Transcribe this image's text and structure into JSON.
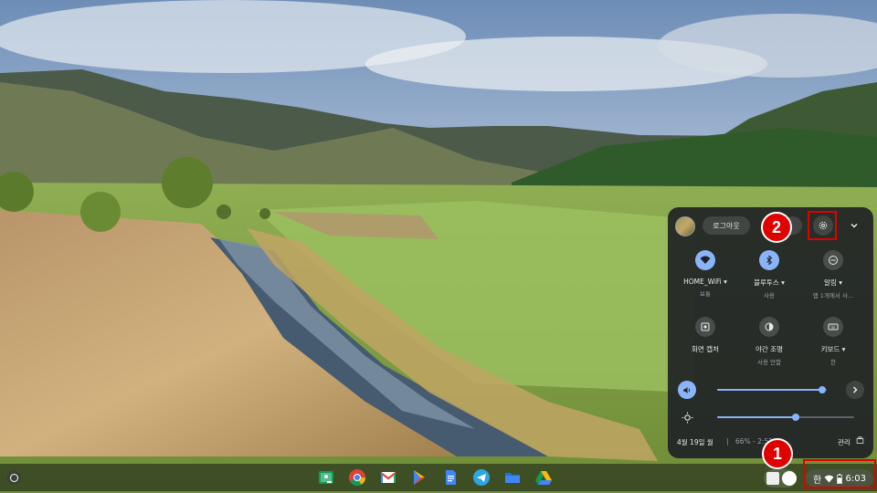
{
  "colors": {
    "accent": "#8ab4f8",
    "annotation": "#e00000",
    "panel": "#202426"
  },
  "shelf": {
    "apps": [
      {
        "name": "classroom-icon"
      },
      {
        "name": "chrome-icon"
      },
      {
        "name": "gmail-icon"
      },
      {
        "name": "play-store-icon"
      },
      {
        "name": "docs-icon"
      },
      {
        "name": "telegram-icon"
      },
      {
        "name": "files-icon"
      },
      {
        "name": "drive-icon"
      }
    ],
    "ime": "한",
    "time": "6:03"
  },
  "quick_settings": {
    "signout_label": "로그아웃",
    "tiles": [
      {
        "label": "HOME_WiFi ▾",
        "sub": "보통",
        "icon": "wifi-icon",
        "state": "on"
      },
      {
        "label": "블루투스 ▾",
        "sub": "사용",
        "icon": "bluetooth-icon",
        "state": "on"
      },
      {
        "label": "알림 ▾",
        "sub": "앱 1개에서 사…",
        "icon": "do-not-disturb-icon",
        "state": "off"
      },
      {
        "label": "화면 캡처",
        "sub": "",
        "icon": "screen-capture-icon",
        "state": "off"
      },
      {
        "label": "야간 조명",
        "sub": "사용 안함",
        "icon": "night-light-icon",
        "state": "off"
      },
      {
        "label": "키보드 ▾",
        "sub": "한",
        "icon": "keyboard-icon",
        "state": "off"
      }
    ],
    "volume_level": 0.96,
    "brightness_level": 0.57,
    "date": "4월 19일 월",
    "separator": "|",
    "battery": "66% - 2:51",
    "manage_label": "관리"
  },
  "annotations": [
    {
      "number": "1",
      "target": "status-area"
    },
    {
      "number": "2",
      "target": "settings-button"
    }
  ]
}
